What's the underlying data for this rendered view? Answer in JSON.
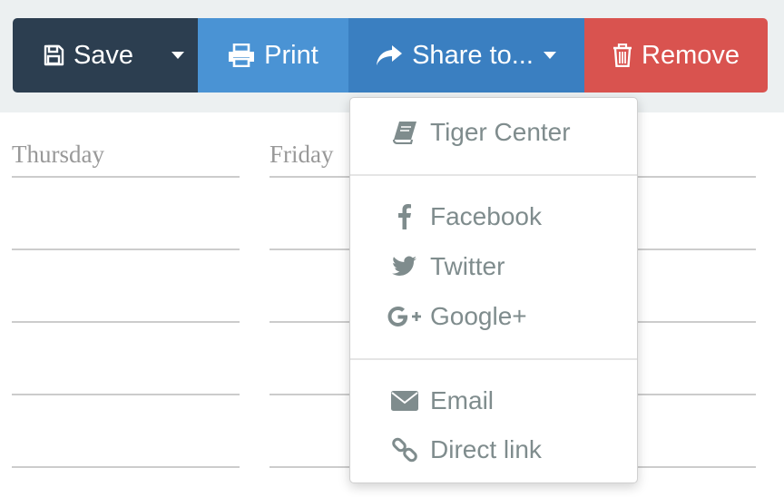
{
  "toolbar": {
    "save_label": "Save",
    "print_label": "Print",
    "share_label": "Share to...",
    "remove_label": "Remove"
  },
  "colors": {
    "save": "#2c3e50",
    "print": "#4a93d4",
    "share": "#3a7fc1",
    "remove": "#d9534f",
    "menu_text": "#7f8c8d"
  },
  "calendar": {
    "days": [
      "Thursday",
      "Friday"
    ]
  },
  "share_menu": {
    "groups": [
      [
        {
          "label": "Tiger Center",
          "icon": "book-icon"
        }
      ],
      [
        {
          "label": "Facebook",
          "icon": "facebook-icon"
        },
        {
          "label": "Twitter",
          "icon": "twitter-icon"
        },
        {
          "label": "Google+",
          "icon": "google-plus-icon"
        }
      ],
      [
        {
          "label": "Email",
          "icon": "envelope-icon"
        },
        {
          "label": "Direct link",
          "icon": "link-icon"
        }
      ]
    ]
  }
}
